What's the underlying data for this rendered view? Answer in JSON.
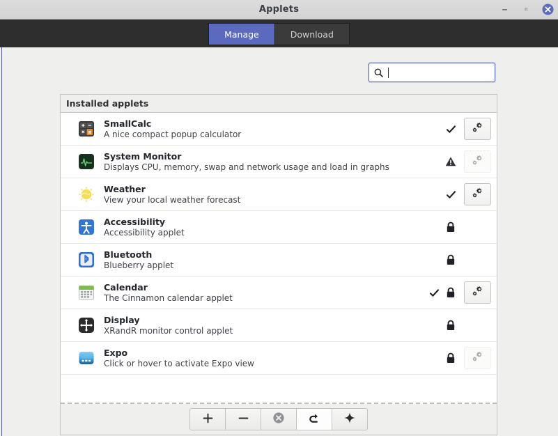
{
  "window": {
    "title": "Applets",
    "buttons": [
      {
        "name": "minimize",
        "glyph": "minimize-icon"
      },
      {
        "name": "maximize",
        "glyph": "maximize-icon"
      },
      {
        "name": "close",
        "glyph": "close-icon"
      }
    ]
  },
  "tabs": [
    {
      "label": "Manage",
      "active": true
    },
    {
      "label": "Download",
      "active": false
    }
  ],
  "search": {
    "value": "",
    "placeholder": "",
    "icon": "search-icon"
  },
  "list": {
    "header": "Installed applets",
    "rows": [
      {
        "icon": "calculator-icon",
        "name": "SmallCalc",
        "description": "A nice compact popup calculator",
        "check": true,
        "warning": false,
        "lock": false,
        "gear": "enabled"
      },
      {
        "icon": "system-monitor-icon",
        "name": "System Monitor",
        "description": "Displays CPU, memory, swap and network usage and load in graphs",
        "check": false,
        "warning": true,
        "lock": false,
        "gear": "disabled"
      },
      {
        "icon": "weather-sun-icon",
        "name": "Weather",
        "description": "View your local weather forecast",
        "check": true,
        "warning": false,
        "lock": false,
        "gear": "enabled"
      },
      {
        "icon": "accessibility-icon",
        "name": "Accessibility",
        "description": "Accessibility applet",
        "check": false,
        "warning": false,
        "lock": true,
        "gear": "none"
      },
      {
        "icon": "bluetooth-icon",
        "name": "Bluetooth",
        "description": "Blueberry applet",
        "check": false,
        "warning": false,
        "lock": true,
        "gear": "none"
      },
      {
        "icon": "calendar-icon",
        "name": "Calendar",
        "description": "The Cinnamon calendar applet",
        "check": true,
        "warning": false,
        "lock": true,
        "gear": "enabled"
      },
      {
        "icon": "display-icon",
        "name": "Display",
        "description": "XRandR monitor control applet",
        "check": false,
        "warning": false,
        "lock": true,
        "gear": "none"
      },
      {
        "icon": "expo-icon",
        "name": "Expo",
        "description": "Click or hover to activate Expo view",
        "check": false,
        "warning": false,
        "lock": true,
        "gear": "disabled"
      }
    ]
  },
  "toolbar": {
    "buttons": [
      {
        "name": "add-applet-button",
        "icon": "plus-icon",
        "glyph": "+",
        "highlight": false
      },
      {
        "name": "remove-applet-button",
        "icon": "minus-icon",
        "glyph": "−",
        "highlight": false
      },
      {
        "name": "uninstall-applet-button",
        "icon": "circle-x-icon",
        "glyph": "",
        "highlight": false
      },
      {
        "name": "restore-defaults-button",
        "icon": "undo-arrow-icon",
        "glyph": "",
        "highlight": true
      },
      {
        "name": "more-actions-button",
        "icon": "sparkle-icon",
        "glyph": "",
        "highlight": false
      }
    ]
  },
  "colors": {
    "accent": "#5b6abf",
    "tabbar_bg": "#2e2e2e",
    "window_bg": "#efefee",
    "titlebar_bg": "#d6d6d6",
    "warning": "#2f3136"
  }
}
